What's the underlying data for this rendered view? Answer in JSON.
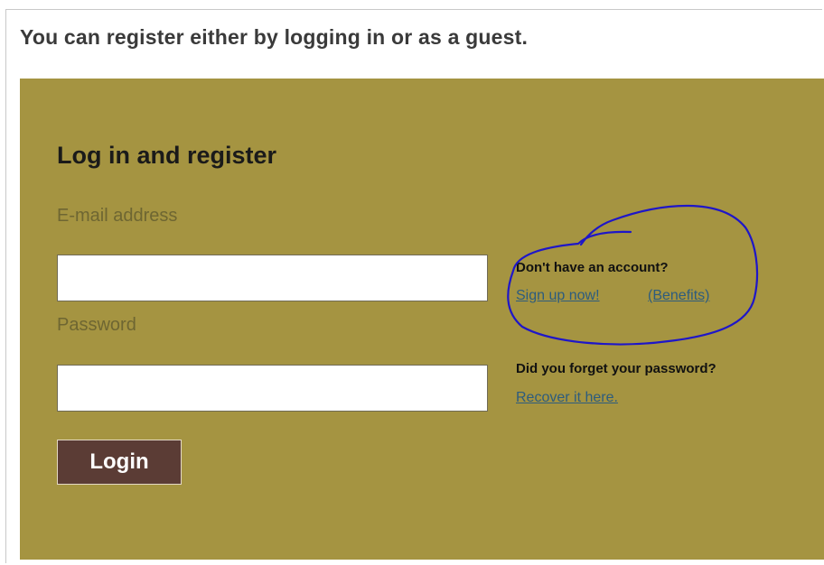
{
  "intro_text": "You can register either by logging in or as a guest.",
  "login_panel": {
    "heading": "Log in and register",
    "email_label": "E-mail address",
    "email_value": "",
    "password_label": "Password",
    "password_value": "",
    "login_button": "Login"
  },
  "account_help": {
    "no_account_text": "Don't have an account?",
    "signup_link": "Sign up now!",
    "benefits_link": "(Benefits)",
    "forgot_text": "Did you forget your password?",
    "recover_link": "Recover it here."
  },
  "colors": {
    "panel": "#a59441",
    "button": "#5b3c35",
    "link": "#2d5c7e",
    "annotation_ink": "#1e16c8"
  }
}
